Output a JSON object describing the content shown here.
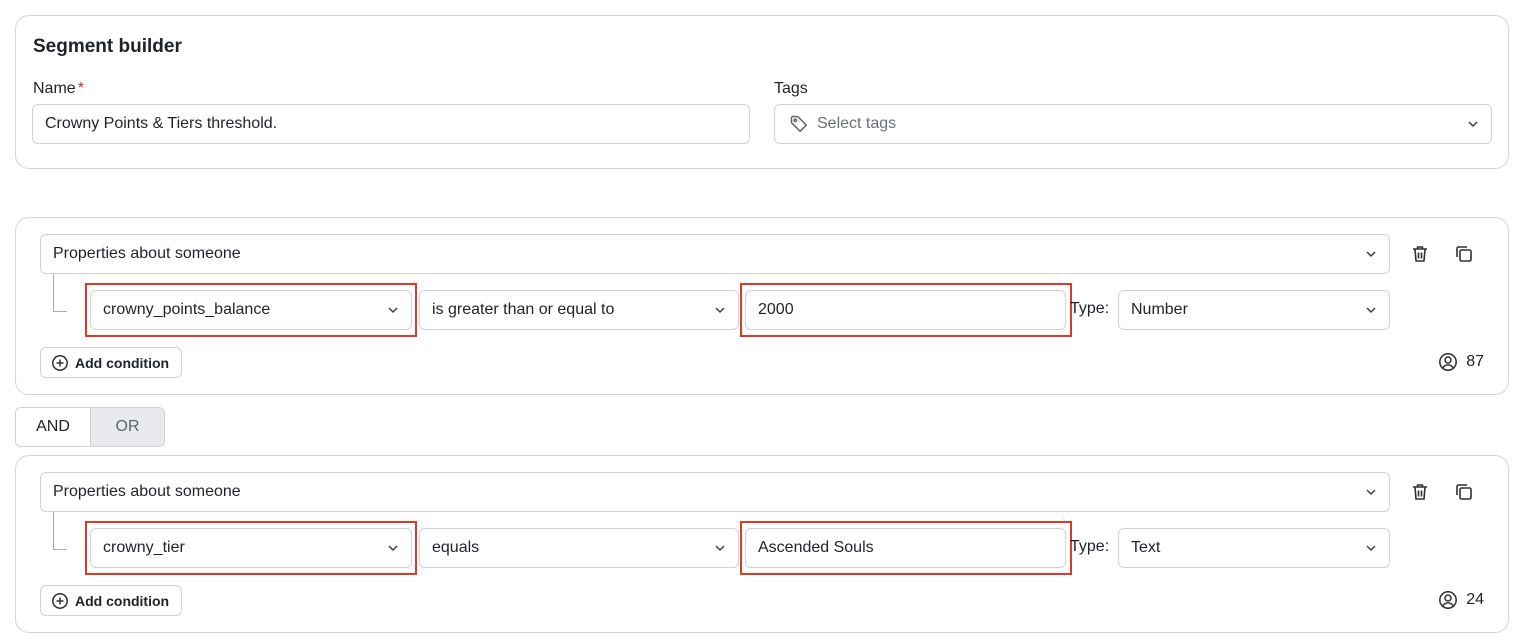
{
  "header": {
    "title": "Segment builder",
    "name_label": "Name",
    "required_mark": "*",
    "name_value": "Crowny Points & Tiers threshold.",
    "tags_label": "Tags",
    "tags_placeholder": "Select tags"
  },
  "rules": [
    {
      "group_select": "Properties about someone",
      "property": "crowny_points_balance",
      "operator": "is greater than or equal to",
      "value": "2000",
      "type_label": "Type:",
      "type_value": "Number",
      "add_condition": "Add condition",
      "count": "87"
    },
    {
      "group_select": "Properties about someone",
      "property": "crowny_tier",
      "operator": "equals",
      "value": "Ascended Souls",
      "type_label": "Type:",
      "type_value": "Text",
      "add_condition": "Add condition",
      "count": "24"
    }
  ],
  "logic": {
    "and_label": "AND",
    "or_label": "OR",
    "selected": "AND"
  },
  "colors": {
    "highlight": "#dd3b25",
    "required": "#d12b2b",
    "border": "#d4d6da"
  }
}
